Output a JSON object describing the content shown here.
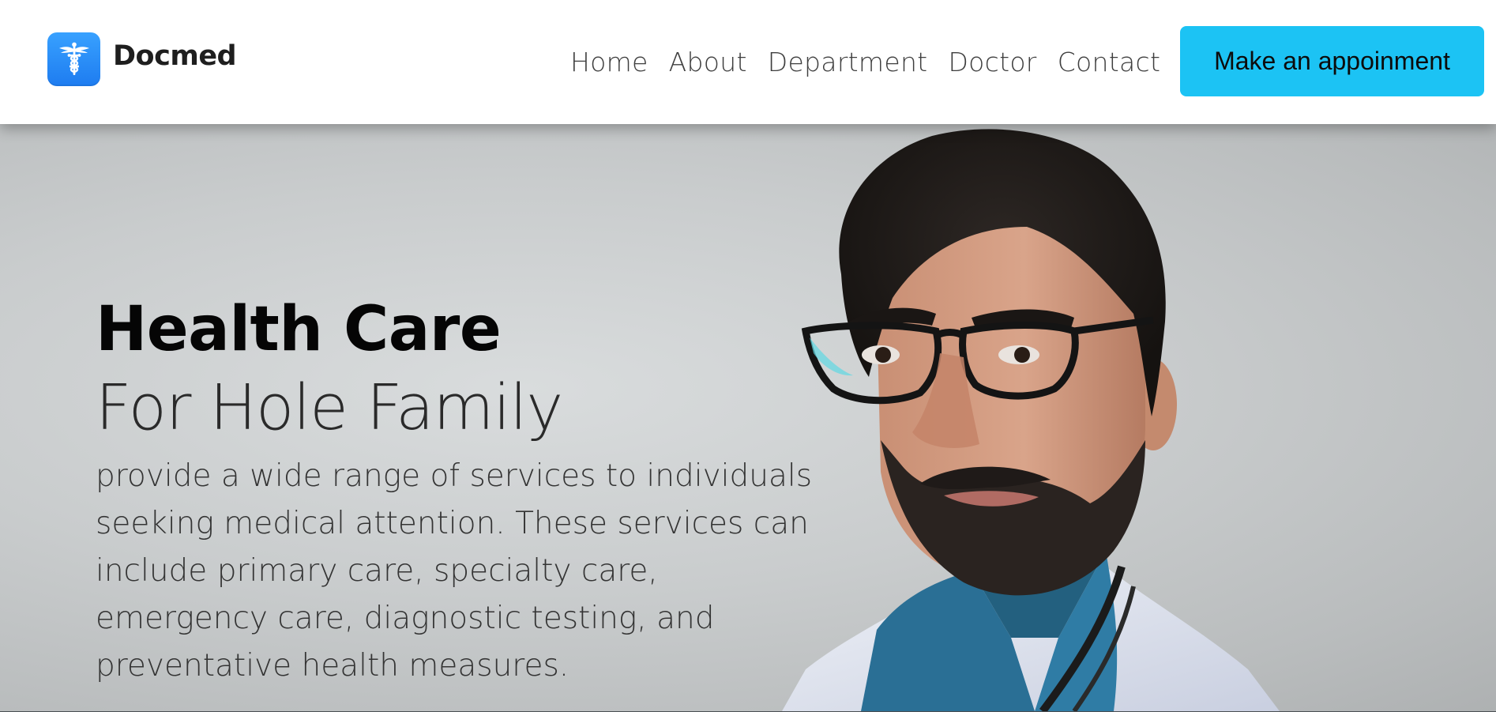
{
  "brand": {
    "name": "Docmed",
    "logo_icon": "caduceus-icon",
    "logo_color": "#1e7cf0"
  },
  "nav": {
    "items": [
      {
        "label": "Home"
      },
      {
        "label": "About"
      },
      {
        "label": "Department"
      },
      {
        "label": "Doctor"
      },
      {
        "label": "Contact"
      }
    ]
  },
  "cta": {
    "label": "Make an appoinment",
    "color": "#1cc3f4"
  },
  "hero": {
    "title": "Health Care",
    "subtitle": "For Hole Family",
    "description": "provide a wide range of services to individuals seeking medical attention. These services can include primary care, specialty care, emergency care, diagnostic testing, and preventative health measures.",
    "image": "doctor-portrait"
  }
}
